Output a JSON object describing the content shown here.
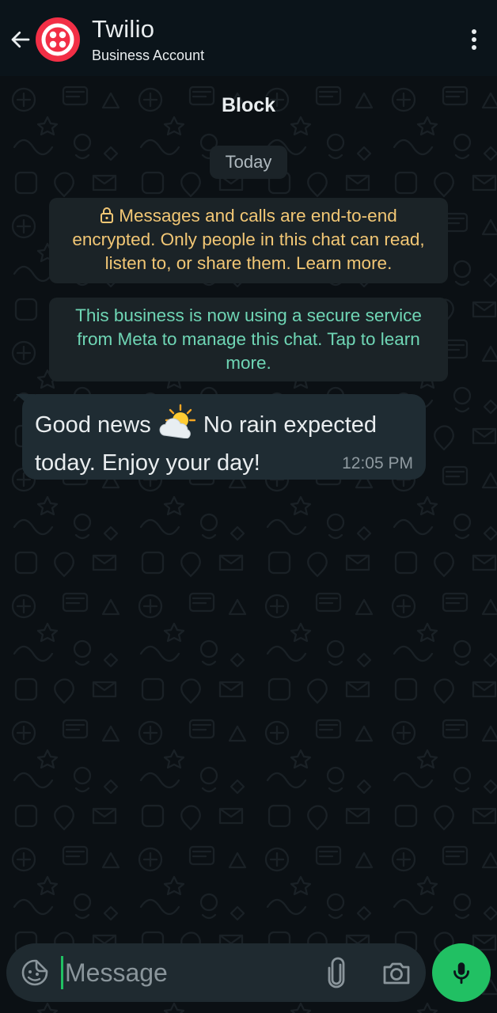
{
  "header": {
    "contact_name": "Twilio",
    "contact_status": "Business Account",
    "avatar_color": "#f22f46"
  },
  "chat": {
    "block_label": "Block",
    "date_chip": "Today",
    "encryption_notice": "Messages and calls are end-to-end encrypted. Only people in this chat can read, listen to, or share them. Learn more.",
    "meta_notice": "This business is now using a secure service from Meta to manage this chat. Tap to learn more.",
    "messages": [
      {
        "direction": "incoming",
        "text_before_emoji": "Good news ",
        "emoji": "sun-behind-cloud",
        "text_after_emoji": " No rain expected today. Enjoy your day!",
        "time": "12:05 PM"
      }
    ]
  },
  "composer": {
    "placeholder": "Message",
    "value": ""
  },
  "icons": {
    "back": "arrow-left-icon",
    "menu": "more-vertical-icon",
    "lock": "lock-icon",
    "emoji": "sticker-emoji-icon",
    "attach": "paperclip-icon",
    "camera": "camera-icon",
    "mic": "mic-icon"
  },
  "colors": {
    "header_bg": "#0b141a",
    "chat_bg": "#0b1014",
    "bubble_bg": "#1f2c33",
    "encryption_text": "#f2c775",
    "meta_text": "#6fd6b5",
    "accent_green": "#21c063"
  }
}
